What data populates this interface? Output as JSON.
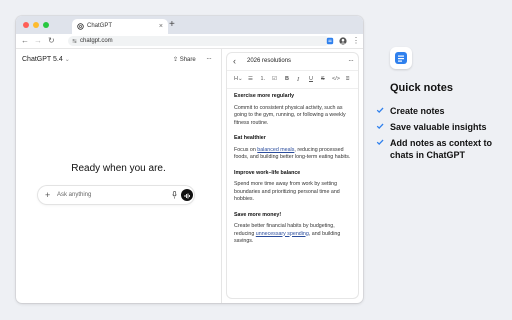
{
  "browser": {
    "tab_title": "ChatGPT",
    "new_tab_glyph": "+",
    "tab_close_glyph": "×",
    "url": "chatgpt.com",
    "traffic_lights": [
      "#ff5f57",
      "#febc2e",
      "#28c840"
    ]
  },
  "chat": {
    "model": "ChatGPT 5.4",
    "share_label": "Share",
    "headline": "Ready when you are.",
    "ask_placeholder": "Ask anything"
  },
  "notes": {
    "title": "2026 resolutions",
    "toolbar": [
      "H",
      "B",
      "I",
      "U",
      "S",
      "</>"
    ],
    "sections": [
      {
        "heading": "Exercise more regularly",
        "body": "Commit to consistent physical activity, such as going to the gym, running, or following a weekly fitness routine."
      },
      {
        "heading": "Eat healthier",
        "body_before": "Focus on ",
        "body_link": "balanced meals",
        "body_after": ", reducing processed foods, and building better long-term eating habits."
      },
      {
        "heading": "Improve work–life balance",
        "body": "Spend more time away from work by setting boundaries and prioritizing personal time and hobbies."
      },
      {
        "heading": "Save more money!",
        "body_before": "Create better financial habits by budgeting, reducing ",
        "body_link": "unnecessary spending",
        "body_after": ", and building savings."
      }
    ]
  },
  "promo": {
    "title": "Quick notes",
    "features": [
      "Create notes",
      "Save valuable insights",
      "Add notes as context to chats in ChatGPT"
    ],
    "accent_color": "#2f80ed"
  }
}
